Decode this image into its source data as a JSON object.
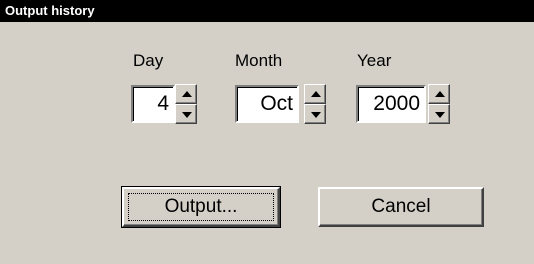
{
  "window": {
    "title": "Output history"
  },
  "date": {
    "day_label": "Day",
    "day_value": "4",
    "month_label": "Month",
    "month_value": "Oct",
    "year_label": "Year",
    "year_value": "2000"
  },
  "buttons": {
    "output_label": "Output...",
    "cancel_label": "Cancel"
  }
}
